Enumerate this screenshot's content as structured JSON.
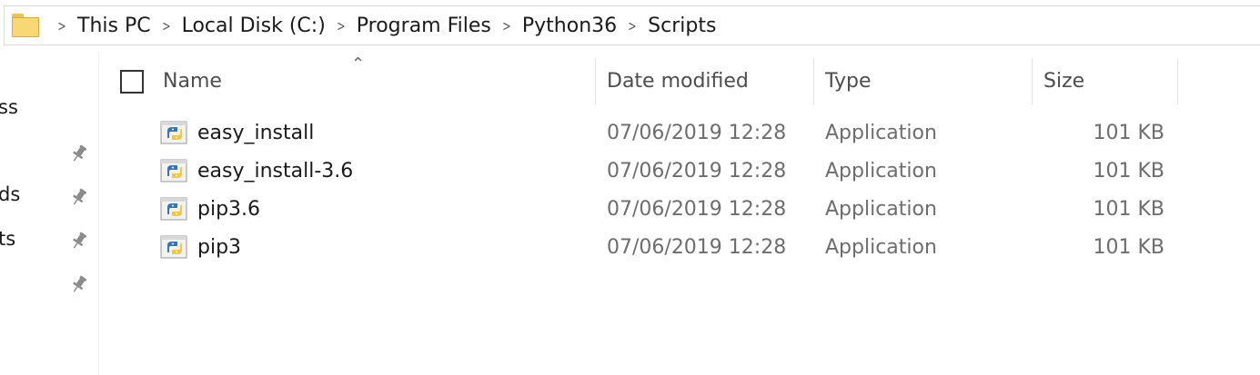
{
  "breadcrumb": {
    "items": [
      "This PC",
      "Local Disk (C:)",
      "Program Files",
      "Python36",
      "Scripts"
    ],
    "separator": ">"
  },
  "nav": {
    "items": [
      "ss",
      "ds",
      "ts"
    ]
  },
  "columns": {
    "name": "Name",
    "date_modified": "Date modified",
    "type": "Type",
    "size": "Size"
  },
  "files": [
    {
      "name": "easy_install",
      "date_modified": "07/06/2019 12:28",
      "type": "Application",
      "size": "101 KB",
      "icon": "python-app-icon"
    },
    {
      "name": "easy_install-3.6",
      "date_modified": "07/06/2019 12:28",
      "type": "Application",
      "size": "101 KB",
      "icon": "python-app-icon"
    },
    {
      "name": "pip3.6",
      "date_modified": "07/06/2019 12:28",
      "type": "Application",
      "size": "101 KB",
      "icon": "python-app-icon"
    },
    {
      "name": "pip3",
      "date_modified": "07/06/2019 12:28",
      "type": "Application",
      "size": "101 KB",
      "icon": "python-app-icon"
    }
  ],
  "colors": {
    "folder": "#f8d775",
    "python_blue": "#3b74b0",
    "python_yellow": "#f5c83c"
  }
}
